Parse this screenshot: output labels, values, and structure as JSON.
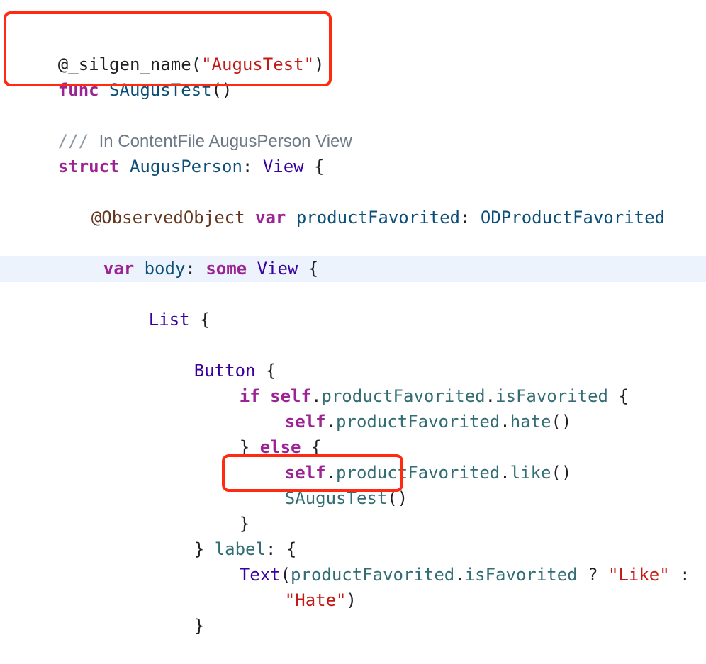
{
  "colors": {
    "keyword": "#9b2393",
    "string": "#c41a16",
    "project_type": "#0b4f79",
    "system_type": "#3900a0",
    "member": "#326d74",
    "comment": "#6c7986",
    "highlight_line": "#edf3fc",
    "annotation_box": "#ff2a10"
  },
  "code": {
    "l1": {
      "a": "@_silgen_name(",
      "b": "\"AugusTest\"",
      "c": ")"
    },
    "l2": {
      "a": "func",
      "b": " ",
      "c": "SAugusTest",
      "d": "()"
    },
    "l3": {
      "marks": "/// ",
      "text": "In ContentFile AugusPerson View"
    },
    "l4": {
      "a": "struct",
      "b": " ",
      "c": "AugusPerson",
      "d": ": ",
      "e": "View",
      "f": " {"
    },
    "l5": {
      "a": "@ObservedObject",
      "b": " ",
      "c": "var",
      "d": " ",
      "e": "productFavorited",
      "f": ": ",
      "g": "ODProductFavorited"
    },
    "l6": {
      "a": "var",
      "b": " ",
      "c": "body",
      "d": ": ",
      "e": "some",
      "f": " ",
      "g": "View",
      "h": " {"
    },
    "l7": {
      "a": "List",
      "b": " {"
    },
    "l8": {
      "a": "Button",
      "b": " {"
    },
    "l9": {
      "a": "if",
      "b": " ",
      "c": "self",
      "d": ".",
      "e": "productFavorited",
      "f": ".",
      "g": "isFavorited",
      "h": " {"
    },
    "l10": {
      "a": "self",
      "b": ".",
      "c": "productFavorited",
      "d": ".",
      "e": "hate",
      "f": "()"
    },
    "l11": {
      "a": "} ",
      "b": "else",
      "c": " {"
    },
    "l12": {
      "a": "self",
      "b": ".",
      "c": "productFavorited",
      "d": ".",
      "e": "like",
      "f": "()"
    },
    "l13": {
      "a": "SAugusTest",
      "b": "()"
    },
    "l14": {
      "a": "}"
    },
    "l15": {
      "a": "} ",
      "b": "label",
      "c": ": {"
    },
    "l16": {
      "a": "Text",
      "b": "(",
      "c": "productFavorited",
      "d": ".",
      "e": "isFavorited",
      "f": " ? ",
      "g": "\"Like\"",
      "h": " :"
    },
    "l17": {
      "a": "\"Hate\"",
      "b": ")"
    },
    "l18": {
      "a": "}"
    }
  }
}
